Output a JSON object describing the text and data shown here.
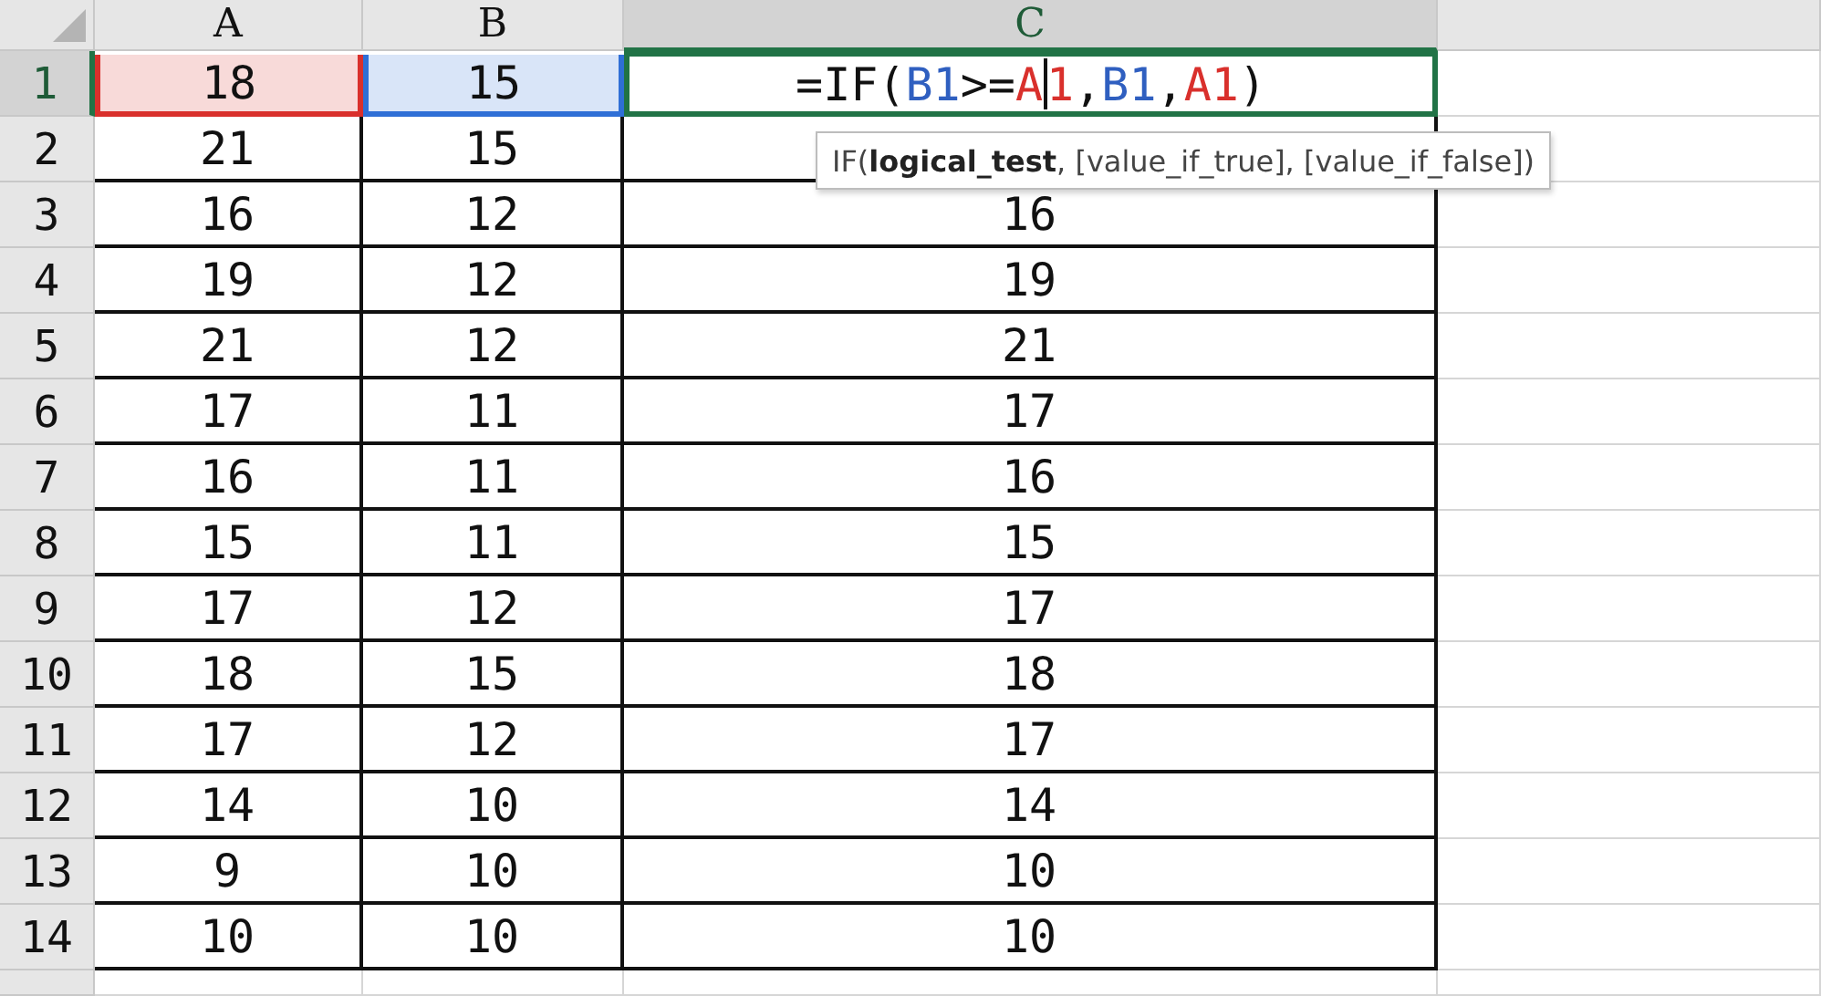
{
  "columns": [
    {
      "label": "A",
      "selected": false
    },
    {
      "label": "B",
      "selected": false
    },
    {
      "label": "C",
      "selected": true
    }
  ],
  "rows": [
    {
      "number": "1",
      "selected": true,
      "cells": [
        {
          "kind": "value",
          "value": "18",
          "color": "#d9302c"
        },
        {
          "kind": "value",
          "value": "15",
          "color": "#2f6fd6"
        },
        {
          "kind": "formula",
          "active": true,
          "tokens": [
            {
              "kind": "text",
              "text": "=IF("
            },
            {
              "kind": "text",
              "text": "B1",
              "color": "#2f5fc0"
            },
            {
              "kind": "text",
              "text": ">="
            },
            {
              "kind": "text",
              "text": "A",
              "color": "#d9302c"
            },
            {
              "kind": "cursor"
            },
            {
              "kind": "text",
              "text": "1",
              "color": "#d9302c"
            },
            {
              "kind": "text",
              "text": ","
            },
            {
              "kind": "text",
              "text": "B1",
              "color": "#2f5fc0"
            },
            {
              "kind": "text",
              "text": ","
            },
            {
              "kind": "text",
              "text": "A1",
              "color": "#d9302c"
            },
            {
              "kind": "text",
              "text": ")"
            }
          ]
        }
      ]
    },
    {
      "number": "2",
      "selected": false,
      "cells": [
        {
          "kind": "value",
          "value": "21"
        },
        {
          "kind": "value",
          "value": "15"
        },
        {
          "kind": "empty"
        }
      ]
    },
    {
      "number": "3",
      "selected": false,
      "cells": [
        {
          "kind": "value",
          "value": "16"
        },
        {
          "kind": "value",
          "value": "12"
        },
        {
          "kind": "value",
          "value": "16"
        }
      ]
    },
    {
      "number": "4",
      "selected": false,
      "cells": [
        {
          "kind": "value",
          "value": "19"
        },
        {
          "kind": "value",
          "value": "12"
        },
        {
          "kind": "value",
          "value": "19"
        }
      ]
    },
    {
      "number": "5",
      "selected": false,
      "cells": [
        {
          "kind": "value",
          "value": "21"
        },
        {
          "kind": "value",
          "value": "12"
        },
        {
          "kind": "value",
          "value": "21"
        }
      ]
    },
    {
      "number": "6",
      "selected": false,
      "cells": [
        {
          "kind": "value",
          "value": "17"
        },
        {
          "kind": "value",
          "value": "11"
        },
        {
          "kind": "value",
          "value": "17"
        }
      ]
    },
    {
      "number": "7",
      "selected": false,
      "cells": [
        {
          "kind": "value",
          "value": "16"
        },
        {
          "kind": "value",
          "value": "11"
        },
        {
          "kind": "value",
          "value": "16"
        }
      ]
    },
    {
      "number": "8",
      "selected": false,
      "cells": [
        {
          "kind": "value",
          "value": "15"
        },
        {
          "kind": "value",
          "value": "11"
        },
        {
          "kind": "value",
          "value": "15"
        }
      ]
    },
    {
      "number": "9",
      "selected": false,
      "cells": [
        {
          "kind": "value",
          "value": "17"
        },
        {
          "kind": "value",
          "value": "12"
        },
        {
          "kind": "value",
          "value": "17"
        }
      ]
    },
    {
      "number": "10",
      "selected": false,
      "cells": [
        {
          "kind": "value",
          "value": "18"
        },
        {
          "kind": "value",
          "value": "15"
        },
        {
          "kind": "value",
          "value": "18"
        }
      ]
    },
    {
      "number": "11",
      "selected": false,
      "cells": [
        {
          "kind": "value",
          "value": "17"
        },
        {
          "kind": "value",
          "value": "12"
        },
        {
          "kind": "value",
          "value": "17"
        }
      ]
    },
    {
      "number": "12",
      "selected": false,
      "cells": [
        {
          "kind": "value",
          "value": "14"
        },
        {
          "kind": "value",
          "value": "10"
        },
        {
          "kind": "value",
          "value": "14"
        }
      ]
    },
    {
      "number": "13",
      "selected": false,
      "cells": [
        {
          "kind": "value",
          "value": "9"
        },
        {
          "kind": "value",
          "value": "10"
        },
        {
          "kind": "value",
          "value": "10"
        }
      ]
    },
    {
      "number": "14",
      "selected": false,
      "cells": [
        {
          "kind": "value",
          "value": "10"
        },
        {
          "kind": "value",
          "value": "10"
        },
        {
          "kind": "value",
          "value": "10"
        }
      ]
    }
  ],
  "tooltip": {
    "text": "IF(**logical_test**, [value_if_true], [value_if_false])"
  }
}
